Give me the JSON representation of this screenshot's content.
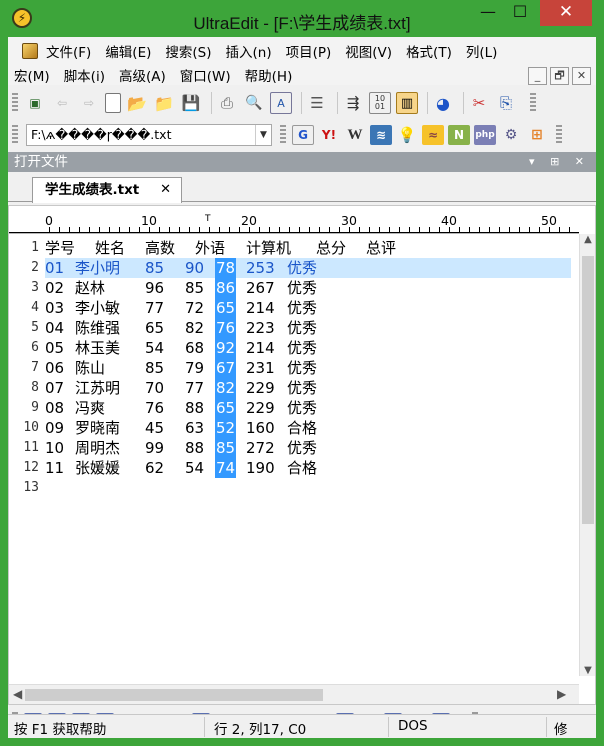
{
  "window": {
    "title": "UltraEdit - [F:\\学生成绩表.txt]",
    "app_icon": "ultraedit-logo-icon",
    "controls": {
      "minimize": "—",
      "maximize": "☐",
      "close": "✕"
    }
  },
  "menubar": {
    "row1": [
      "文件(F)",
      "编辑(E)",
      "搜索(S)",
      "插入(n)",
      "项目(P)",
      "视图(V)",
      "格式(T)",
      "列(L)"
    ],
    "row2": [
      "宏(M)",
      "脚本(i)",
      "高级(A)",
      "窗口(W)",
      "帮助(H)"
    ],
    "mdi_buttons": [
      "_",
      "🗗",
      "✕"
    ]
  },
  "toolbar": {
    "path": "F:\\ѧ����ɼ���.txt"
  },
  "open_files_panel": {
    "title": "打开文件"
  },
  "tabs": [
    {
      "label": "学生成绩表.txt",
      "close": "✕",
      "active": true
    }
  ],
  "ruler": {
    "labels": [
      "0",
      "10",
      "20",
      "30",
      "40",
      "50"
    ]
  },
  "document": {
    "current_line": 2,
    "selected_column": 17,
    "line_numbers": [
      "1",
      "2",
      "3",
      "4",
      "5",
      "6",
      "7",
      "8",
      "9",
      "10",
      "11",
      "12",
      "13"
    ],
    "rows": [
      {
        "no": "学号",
        "name": "姓名",
        "math": "高数",
        "english": "外语",
        "computer": "计算机",
        "total": "总分",
        "grade": "总评"
      },
      {
        "no": "01",
        "name": "李小明",
        "math": "85",
        "english": "90",
        "computer": "78",
        "total": "253",
        "grade": "优秀"
      },
      {
        "no": "02",
        "name": "赵林",
        "math": "96",
        "english": "85",
        "computer": "86",
        "total": "267",
        "grade": "优秀"
      },
      {
        "no": "03",
        "name": "李小敏",
        "math": "77",
        "english": "72",
        "computer": "65",
        "total": "214",
        "grade": "优秀"
      },
      {
        "no": "04",
        "name": "陈维强",
        "math": "65",
        "english": "82",
        "computer": "76",
        "total": "223",
        "grade": "优秀"
      },
      {
        "no": "05",
        "name": "林玉美",
        "math": "54",
        "english": "68",
        "computer": "92",
        "total": "214",
        "grade": "优秀"
      },
      {
        "no": "06",
        "name": "陈山",
        "math": "85",
        "english": "79",
        "computer": "67",
        "total": "231",
        "grade": "优秀"
      },
      {
        "no": "07",
        "name": "江苏明",
        "math": "70",
        "english": "77",
        "computer": "82",
        "total": "229",
        "grade": "优秀"
      },
      {
        "no": "08",
        "name": "冯爽",
        "math": "76",
        "english": "88",
        "computer": "65",
        "total": "229",
        "grade": "优秀"
      },
      {
        "no": "09",
        "name": "罗晓南",
        "math": "45",
        "english": "63",
        "computer": "52",
        "total": "160",
        "grade": "合格"
      },
      {
        "no": "10",
        "name": "周明杰",
        "math": "99",
        "english": "88",
        "computer": "85",
        "total": "272",
        "grade": "优秀"
      },
      {
        "no": "11",
        "name": "张媛媛",
        "math": "62",
        "english": "54",
        "computer": "74",
        "total": "190",
        "grade": "合格"
      }
    ]
  },
  "statusbar": {
    "help": "按 F1 获取帮助",
    "position": "行 2, 列17, C0",
    "line_ending": "DOS",
    "mode": "修"
  },
  "colors": {
    "titlebar": "#3da53a",
    "selection": "#3399ff",
    "current_line": "#cce8ff",
    "current_line_text": "#1a55c8",
    "close_button": "#c7443a"
  }
}
